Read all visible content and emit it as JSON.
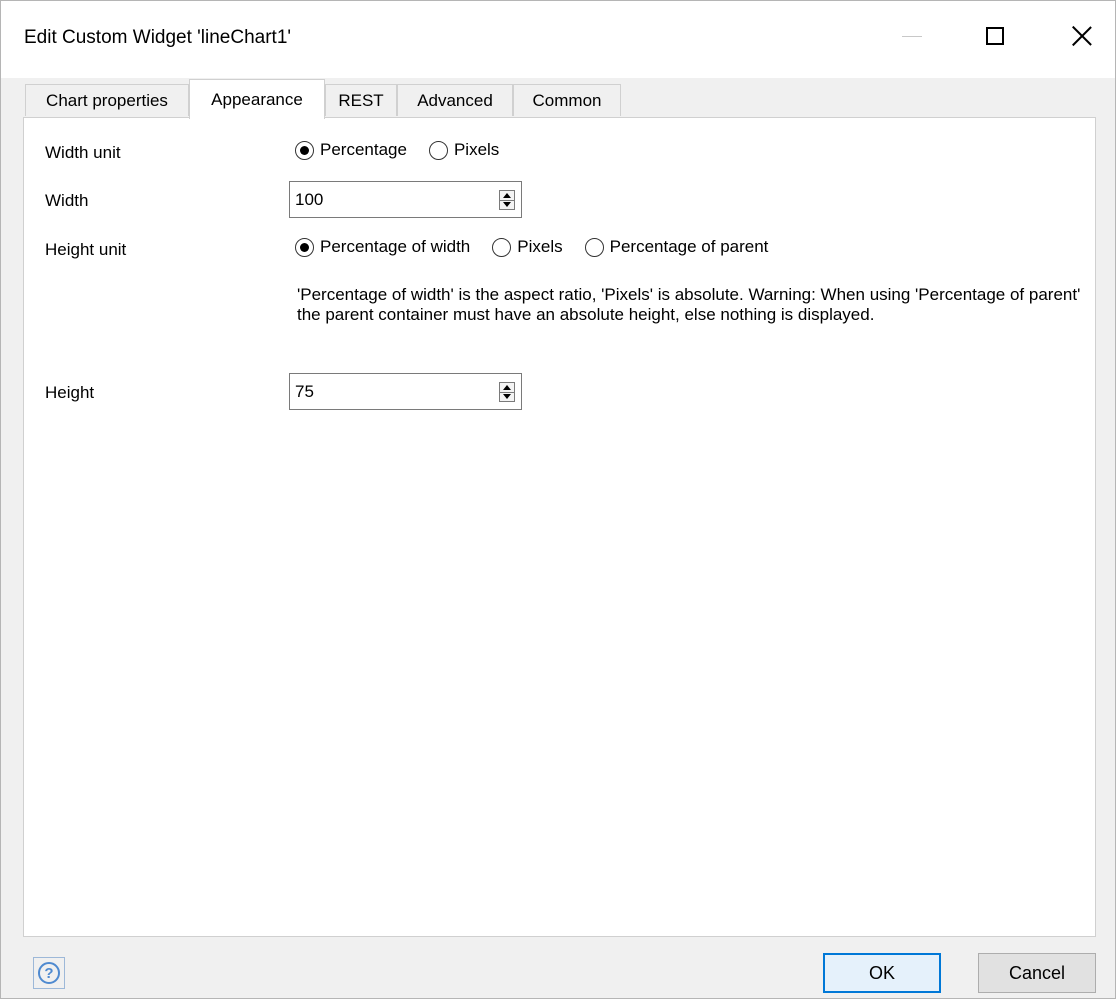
{
  "window": {
    "title": "Edit Custom Widget 'lineChart1'"
  },
  "tabs": [
    {
      "label": "Chart properties",
      "active": false
    },
    {
      "label": "Appearance",
      "active": true
    },
    {
      "label": "REST",
      "active": false
    },
    {
      "label": "Advanced",
      "active": false
    },
    {
      "label": "Common",
      "active": false
    }
  ],
  "form": {
    "width_unit": {
      "label": "Width unit",
      "options": [
        {
          "label": "Percentage",
          "checked": true
        },
        {
          "label": "Pixels",
          "checked": false
        }
      ]
    },
    "width": {
      "label": "Width",
      "value": "100"
    },
    "height_unit": {
      "label": "Height unit",
      "options": [
        {
          "label": "Percentage of width",
          "checked": true
        },
        {
          "label": "Pixels",
          "checked": false
        },
        {
          "label": "Percentage of parent",
          "checked": false
        }
      ],
      "hint": "'Percentage of width' is the aspect ratio, 'Pixels' is absolute. Warning: When using 'Percentage of parent' the parent container must have an absolute height, else nothing is displayed."
    },
    "height": {
      "label": "Height",
      "value": "75"
    }
  },
  "footer": {
    "help_glyph": "?",
    "ok_label": "OK",
    "cancel_label": "Cancel"
  },
  "icons": {
    "minimize": "minimize-icon",
    "maximize": "maximize-icon",
    "close": "close-icon",
    "help": "help-icon"
  },
  "colors": {
    "accent": "#0078d7",
    "help": "#4f8ad0"
  }
}
